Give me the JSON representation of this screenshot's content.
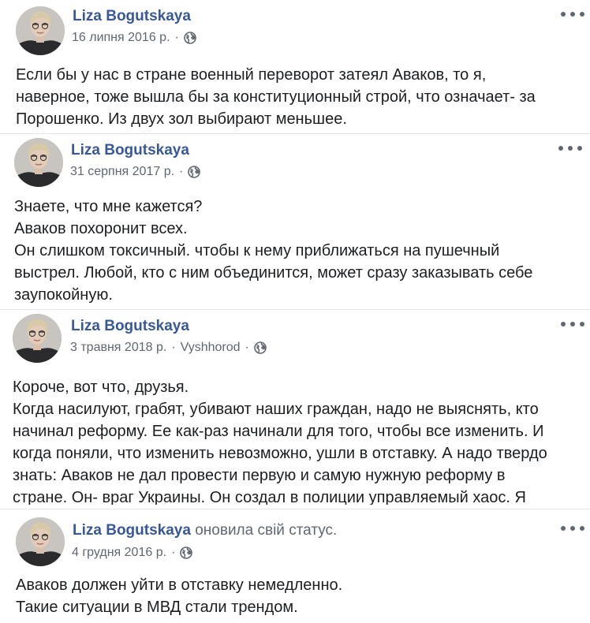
{
  "posts": [
    {
      "author": "Liza Bogutskaya",
      "action": "",
      "date": "16 липня 2016 р.",
      "location": "",
      "text": "Если бы у нас в стране военный переворот затеял Аваков, то я,\nнаверное, тоже вышла бы за конституционный строй, что означает- за\nПорошенко. Из двух зол выбирают меньшее."
    },
    {
      "author": "Liza Bogutskaya",
      "action": "",
      "date": "31 серпня 2017 р.",
      "location": "",
      "text": "Знаете, что мне кажется?\nАваков похоронит всех.\nОн слишком токсичный. чтобы к нему приближаться на пушечный\nвыстрел. Любой, кто с ним объединится, может сразу заказывать себе\nзаупокойную."
    },
    {
      "author": "Liza Bogutskaya",
      "action": "",
      "date": "3 травня 2018 р.",
      "location": "Vyshhorod",
      "text": "Короче, вот что, друзья.\nКогда насилуют, грабят, убивают наших граждан, надо не выяснять, кто\nначинал реформу. Ее как-раз начинали для того, чтобы все изменить. И\nкогда поняли, что изменить невозможно, ушли в отставку. А надо твердо\nзнать: Аваков не дал провести первую и самую нужную реформу в\nстране. Он- враг Украины. Он создал в полиции управляемый хаос. Я"
    },
    {
      "author": "Liza Bogutskaya",
      "action": "оновила свій статус.",
      "date": "4 грудня 2016 р.",
      "location": "",
      "text": "Аваков должен уйти в отставку немедленно.\nТакие ситуации в МВД стали трендом."
    }
  ],
  "ui": {
    "more_icon": "more-horizontal-icon",
    "privacy_icon": "globe-icon",
    "separator": "·"
  },
  "colors": {
    "author": "#385898",
    "meta": "#606770",
    "text": "#1c1e21",
    "background": "#ffffff"
  }
}
